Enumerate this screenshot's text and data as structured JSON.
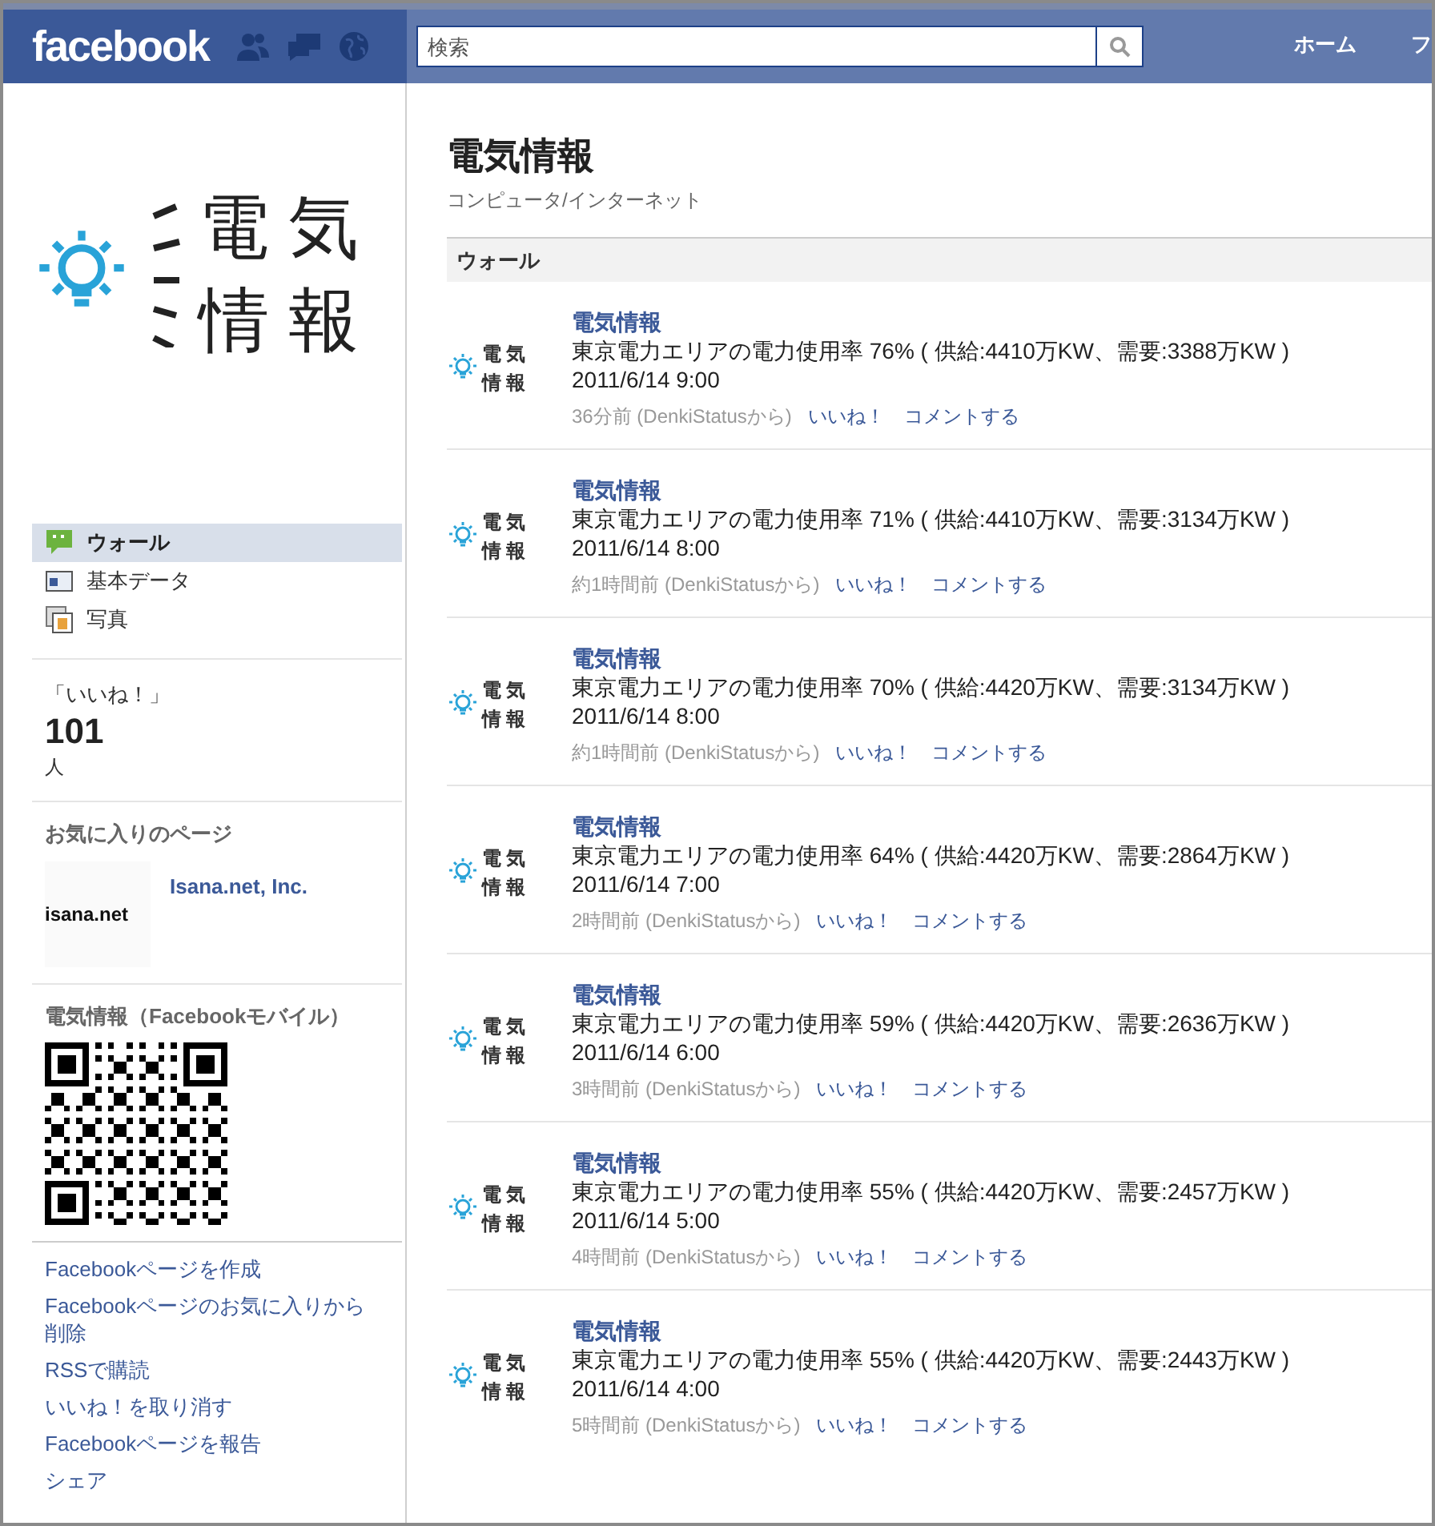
{
  "header": {
    "logo": "facebook",
    "search": {
      "placeholder": "検索"
    },
    "nav": [
      "ホーム",
      "フ"
    ]
  },
  "sidebar": {
    "logo_text": [
      "電気",
      "情報"
    ],
    "nav": [
      {
        "label": "ウォール",
        "selected": true
      },
      {
        "label": "基本データ",
        "selected": false
      },
      {
        "label": "写真",
        "selected": false
      }
    ],
    "likes": {
      "label": "「いいね！」",
      "count": "101",
      "unit": "人"
    },
    "favorites": {
      "heading": "お気に入りのページ",
      "items": [
        {
          "name": "Isana.net, Inc.",
          "logo": "isana.net"
        }
      ]
    },
    "mobile": {
      "heading": "電気情報（Facebookモバイル）"
    },
    "links": [
      "Facebookページを作成",
      "Facebookページのお気に入りから削除",
      "RSSで購読",
      "いいね！を取り消す",
      "Facebookページを報告",
      "シェア"
    ]
  },
  "page": {
    "title": "電気情報",
    "category": "コンピュータ/インターネット",
    "section": "ウォール"
  },
  "posts": [
    {
      "avatar": [
        "電気",
        "情報"
      ],
      "author": "電気情報",
      "text": "東京電力エリアの電力使用率 76% ( 供給:4410万KW、需要:3388万KW )",
      "date": "2011/6/14 9:00",
      "time": "36分前 (DenkiStatusから)",
      "like": "いいね！",
      "comment": "コメントする"
    },
    {
      "avatar": [
        "電気",
        "情報"
      ],
      "author": "電気情報",
      "text": "東京電力エリアの電力使用率 71% ( 供給:4410万KW、需要:3134万KW )",
      "date": "2011/6/14 8:00",
      "time": "約1時間前 (DenkiStatusから)",
      "like": "いいね！",
      "comment": "コメントする"
    },
    {
      "avatar": [
        "電気",
        "情報"
      ],
      "author": "電気情報",
      "text": "東京電力エリアの電力使用率 70% ( 供給:4420万KW、需要:3134万KW )",
      "date": "2011/6/14 8:00",
      "time": "約1時間前 (DenkiStatusから)",
      "like": "いいね！",
      "comment": "コメントする"
    },
    {
      "avatar": [
        "電気",
        "情報"
      ],
      "author": "電気情報",
      "text": "東京電力エリアの電力使用率 64% ( 供給:4420万KW、需要:2864万KW )",
      "date": "2011/6/14 7:00",
      "time": "2時間前 (DenkiStatusから)",
      "like": "いいね！",
      "comment": "コメントする"
    },
    {
      "avatar": [
        "電気",
        "情報"
      ],
      "author": "電気情報",
      "text": "東京電力エリアの電力使用率 59% ( 供給:4420万KW、需要:2636万KW )",
      "date": "2011/6/14 6:00",
      "time": "3時間前 (DenkiStatusから)",
      "like": "いいね！",
      "comment": "コメントする"
    },
    {
      "avatar": [
        "電気",
        "情報"
      ],
      "author": "電気情報",
      "text": "東京電力エリアの電力使用率 55% ( 供給:4420万KW、需要:2457万KW )",
      "date": "2011/6/14 5:00",
      "time": "4時間前 (DenkiStatusから)",
      "like": "いいね！",
      "comment": "コメントする"
    },
    {
      "avatar": [
        "電気",
        "情報"
      ],
      "author": "電気情報",
      "text": "東京電力エリアの電力使用率 55% ( 供給:4420万KW、需要:2443万KW )",
      "date": "2011/6/14 4:00",
      "time": "5時間前 (DenkiStatusから)",
      "like": "いいね！",
      "comment": "コメントする"
    }
  ]
}
